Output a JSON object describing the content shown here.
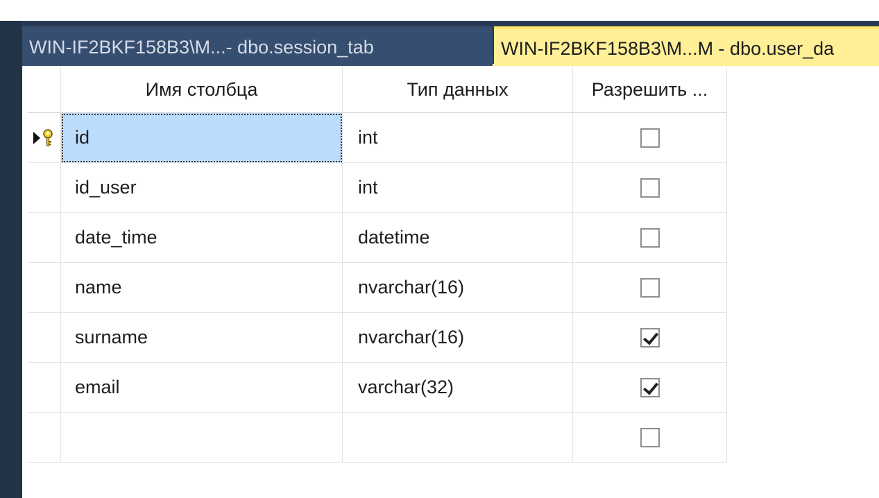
{
  "tabs": [
    {
      "label": "WIN-IF2BKF158B3\\M...- dbo.session_tab",
      "active": false
    },
    {
      "label": "WIN-IF2BKF158B3\\M...M - dbo.user_da",
      "active": true
    }
  ],
  "grid": {
    "headers": {
      "column_name": "Имя столбца",
      "data_type": "Тип данных",
      "allow_nulls": "Разрешить ..."
    },
    "rows": [
      {
        "name": "id",
        "type": "int",
        "allow_nulls": false,
        "primary_key": true,
        "selected": true
      },
      {
        "name": "id_user",
        "type": "int",
        "allow_nulls": false
      },
      {
        "name": "date_time",
        "type": "datetime",
        "allow_nulls": false
      },
      {
        "name": "name",
        "type": "nvarchar(16)",
        "allow_nulls": false
      },
      {
        "name": "surname",
        "type": "nvarchar(16)",
        "allow_nulls": true
      },
      {
        "name": "email",
        "type": "varchar(32)",
        "allow_nulls": true
      },
      {
        "name": "",
        "type": "",
        "allow_nulls": false
      }
    ]
  },
  "colors": {
    "tab_strip": "#293955",
    "active_tab": "#ffef97",
    "selection": "#bcdcfc"
  },
  "icons": {
    "row_indicator": "current-row-arrow-icon",
    "key": "primary-key-icon"
  }
}
